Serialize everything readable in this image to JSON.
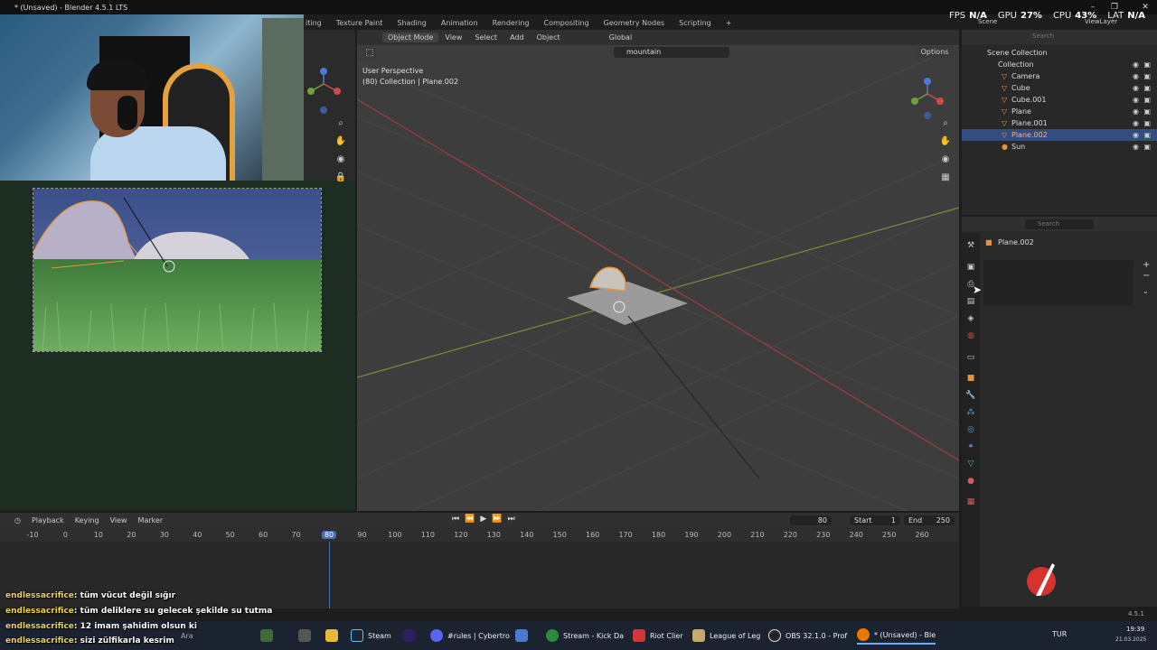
{
  "window": {
    "title": "* (Unsaved) - Blender 4.5.1 LTS",
    "controls": [
      "–",
      "❐",
      "✕"
    ]
  },
  "menubar": [
    "iting",
    "Texture Paint",
    "Shading",
    "Animation",
    "Rendering",
    "Compositing",
    "Geometry Nodes",
    "Scripting",
    "+"
  ],
  "stats": {
    "fps_label": "FPS",
    "fps_value": "N/A",
    "gpu_label": "GPU",
    "gpu_value": "27%",
    "cpu_label": "CPU",
    "cpu_value": "43%",
    "lat_label": "LAT",
    "lat_value": "N/A"
  },
  "top_right": {
    "scene": "Scene",
    "view_layer": "ViewLayer"
  },
  "viewport": {
    "mode": "Object Mode",
    "menus": [
      "View",
      "Select",
      "Add",
      "Object"
    ],
    "orientation": "Global",
    "search_value": "mountain",
    "options": "Options",
    "info_line1": "User Perspective",
    "info_line2": "(80) Collection | Plane.002"
  },
  "outliner": {
    "search_placeholder": "Search",
    "root": "Scene Collection",
    "collection": "Collection",
    "items": [
      {
        "name": "Camera",
        "selected": false
      },
      {
        "name": "Cube",
        "selected": false
      },
      {
        "name": "Cube.001",
        "selected": false
      },
      {
        "name": "Plane",
        "selected": false
      },
      {
        "name": "Plane.001",
        "selected": false
      },
      {
        "name": "Plane.002",
        "selected": true
      },
      {
        "name": "Sun",
        "selected": false
      }
    ]
  },
  "properties": {
    "search_placeholder": "Search",
    "object_name": "Plane.002"
  },
  "timeline": {
    "menus": [
      "Playback",
      "Keying",
      "View",
      "Marker"
    ],
    "current_frame": "80",
    "start_label": "Start",
    "start": "1",
    "end_label": "End",
    "end": "250",
    "ruler": [
      "-10",
      "0",
      "10",
      "20",
      "30",
      "40",
      "50",
      "60",
      "70",
      "80",
      "90",
      "100",
      "110",
      "120",
      "130",
      "140",
      "150",
      "160",
      "170",
      "180",
      "190",
      "200",
      "210",
      "220",
      "230",
      "240",
      "250",
      "260"
    ]
  },
  "chat": [
    {
      "user": "endlessacrifice",
      "text": ": tüm vücut değil sığır"
    },
    {
      "user": "endlessacrifice",
      "text": ": tüm deliklere su gelecek şekilde su tutma"
    },
    {
      "user": "endlessacrifice",
      "text": ": 12 imam şahidim olsun ki"
    },
    {
      "user": "endlessacrifice",
      "text": ": sizi zülfikarla kesrim"
    }
  ],
  "taskbar": {
    "search": "Ara",
    "apps": [
      {
        "label": "Steam",
        "color": "#1b2838"
      },
      {
        "label": "",
        "color": "#2d1f5e"
      },
      {
        "label": "#rules | Cybertro",
        "color": "#5865f2"
      },
      {
        "label": "Stream - Kick Da",
        "color": "#2a8c3c"
      },
      {
        "label": "Riot Clier",
        "color": "#d13639"
      },
      {
        "label": "League of Leg",
        "color": "#c8aa6e"
      },
      {
        "label": "OBS 32.1.0 - Prof",
        "color": "#222222"
      },
      {
        "label": "* (Unsaved) - Ble",
        "color": "#ea7600"
      }
    ],
    "lang": "TUR",
    "time": "19:39",
    "date": "21.03.2025"
  },
  "version": "4.5.1",
  "colors": {
    "accent": "#4772b3",
    "selection": "#334d80",
    "object_orange": "#e8953a",
    "x_axis": "#a33c3c",
    "y_axis": "#6b8e23",
    "chat_user": "#f2d34b"
  }
}
